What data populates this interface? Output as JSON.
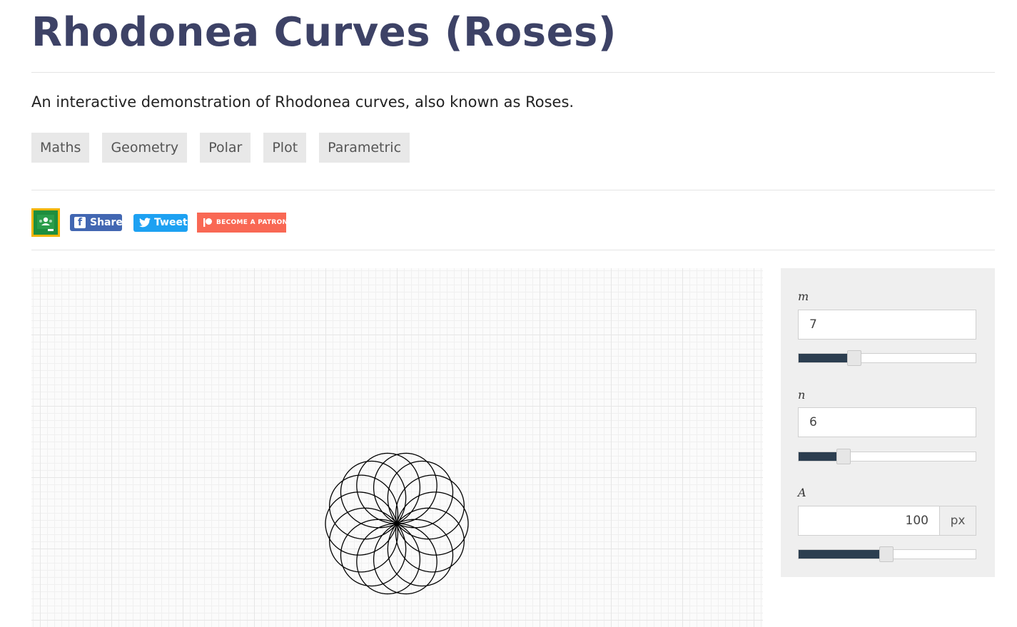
{
  "page": {
    "title": "Rhodonea Curves (Roses)",
    "description": "An interactive demonstration of Rhodonea curves, also known as Roses."
  },
  "tags": [
    "Maths",
    "Geometry",
    "Polar",
    "Plot",
    "Parametric"
  ],
  "share": {
    "facebook_label": "Share",
    "twitter_label": "Tweet",
    "patreon_label": "BECOME A PATRON",
    "classroom_icon": "google-classroom-icon",
    "colors": {
      "facebook": "#4267b2",
      "twitter": "#1da1f2",
      "patreon": "#f96854",
      "classroom": "#1e8e3e"
    }
  },
  "controls": {
    "m": {
      "label": "m",
      "value": "7",
      "slider_fraction": 0.31
    },
    "n": {
      "label": "n",
      "value": "6",
      "slider_fraction": 0.25
    },
    "A": {
      "label": "A",
      "value": "100",
      "unit": "px",
      "slider_fraction": 0.49
    }
  },
  "plot": {
    "type": "rhodonea",
    "m": 7,
    "n": 6,
    "A": 100,
    "stroke": "#000000"
  },
  "colors": {
    "title": "#3d4266",
    "slider_fill": "#2c3e50"
  }
}
